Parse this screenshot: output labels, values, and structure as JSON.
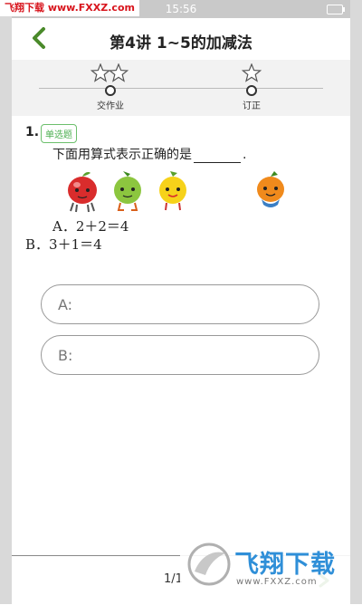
{
  "status_bar": {
    "time": "15:56"
  },
  "watermark_top": "飞翔下载 www.FXXZ.com",
  "header": {
    "title": "第4讲 1~5的加减法"
  },
  "progress": {
    "steps": [
      {
        "label": "交作业",
        "stars": 2
      },
      {
        "label": "订正",
        "stars": 1
      }
    ]
  },
  "question": {
    "number": "1.",
    "type": "单选题",
    "text": "下面用算式表示正确的是",
    "end_mark": ".",
    "options": [
      {
        "text": "A．2＋2＝4"
      },
      {
        "text": "B．3＋1＝4"
      }
    ]
  },
  "choices": [
    {
      "label": "A:"
    },
    {
      "label": "B:"
    }
  ],
  "footer": {
    "page": "1/1"
  },
  "brand_watermark": {
    "name": "飞翔下载",
    "url": "www.FXXZ.com"
  },
  "colors": {
    "accent_green": "#4caf50",
    "brand_blue": "#2f8fd8",
    "watermark_red": "#d8141c"
  }
}
